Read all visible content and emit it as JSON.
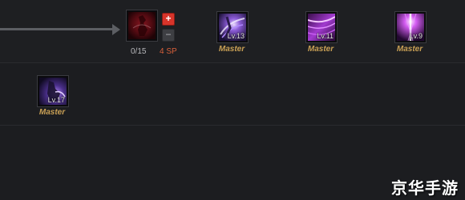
{
  "skills": [
    {
      "id": "locked-skill",
      "current_points": "0/15",
      "sp_cost": "4 SP"
    },
    {
      "id": "skill-2",
      "level": "Lv.13",
      "rank": "Master"
    },
    {
      "id": "skill-3",
      "level": "Lv.11",
      "rank": "Master"
    },
    {
      "id": "skill-4",
      "level": "Lv.9",
      "rank": "Master"
    },
    {
      "id": "skill-5",
      "level": "Lv.17",
      "rank": "Master"
    }
  ],
  "controls": {
    "plus_label": "+",
    "minus_label": "−"
  },
  "watermark": "京华手游",
  "colors": {
    "master_gold": "#c9a055",
    "sp_orange": "#d9603a",
    "plus_red": "#d7342a",
    "background": "#1c1d20"
  }
}
